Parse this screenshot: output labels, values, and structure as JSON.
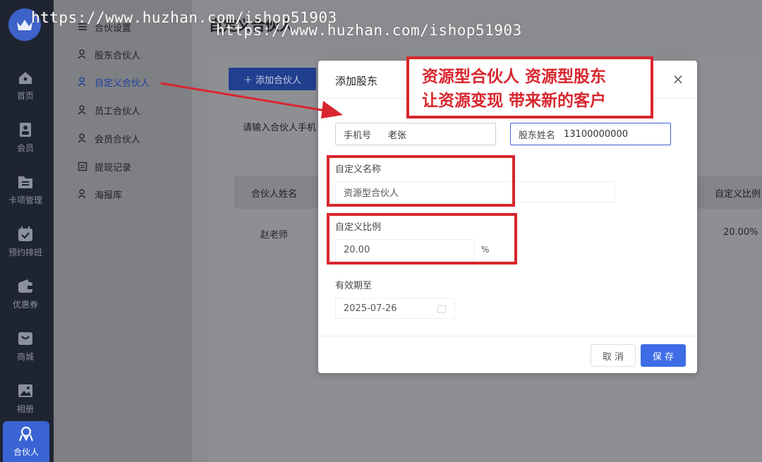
{
  "rail": {
    "items": [
      {
        "label": "首页",
        "icon": "home-icon"
      },
      {
        "label": "会员",
        "icon": "member-icon"
      },
      {
        "label": "卡项管理",
        "icon": "card-icon"
      },
      {
        "label": "预约排班",
        "icon": "calendar-icon"
      },
      {
        "label": "优惠券",
        "icon": "wallet-icon"
      },
      {
        "label": "商城",
        "icon": "bag-icon"
      },
      {
        "label": "相册",
        "icon": "photo-icon"
      },
      {
        "label": "合伙人",
        "icon": "partner-icon"
      }
    ],
    "active_color": "#3a63d3"
  },
  "subnav": {
    "items": [
      {
        "label": "合伙设置",
        "icon": "menu-icon"
      },
      {
        "label": "股东合伙人",
        "icon": "person-icon"
      },
      {
        "label": "自定义合伙人",
        "icon": "person-icon"
      },
      {
        "label": "员工合伙人",
        "icon": "person-icon"
      },
      {
        "label": "会员合伙人",
        "icon": "person-icon"
      },
      {
        "label": "提现记录",
        "icon": "list-icon"
      },
      {
        "label": "海报库",
        "icon": "person-icon"
      }
    ],
    "active_index": 2
  },
  "main": {
    "title": "自定义合伙人",
    "add_button": "＋ 添加合伙人",
    "search_label": "请输入合伙人手机",
    "table": {
      "headers": {
        "name": "合伙人姓名",
        "ratio": "自定义比例"
      },
      "rows": [
        {
          "name": "赵老师",
          "ratio": "20.00%"
        }
      ]
    }
  },
  "modal": {
    "title": "添加股东",
    "close": "×",
    "phone_label": "手机号",
    "phone_value": "老张",
    "name_label": "股东姓名",
    "name_value": "13100000000",
    "custom_name_label": "自定义名称",
    "custom_name_value": "资源型合伙人",
    "custom_ratio_label": "自定义比例",
    "custom_ratio_value": "20.00",
    "custom_ratio_suffix": "%",
    "expiry_label": "有效期至",
    "expiry_value": "2025-07-26",
    "cancel": "取 消",
    "save": "保 存"
  },
  "callout": {
    "line1": "资源型合伙人 资源型股东",
    "line2": "让资源变现 带来新的客户",
    "color": "#d8262e"
  },
  "watermark": {
    "text1": "https://www.huzhan.com/ishop51903",
    "text2": "https://www.huzhan.com/ishop51903"
  }
}
